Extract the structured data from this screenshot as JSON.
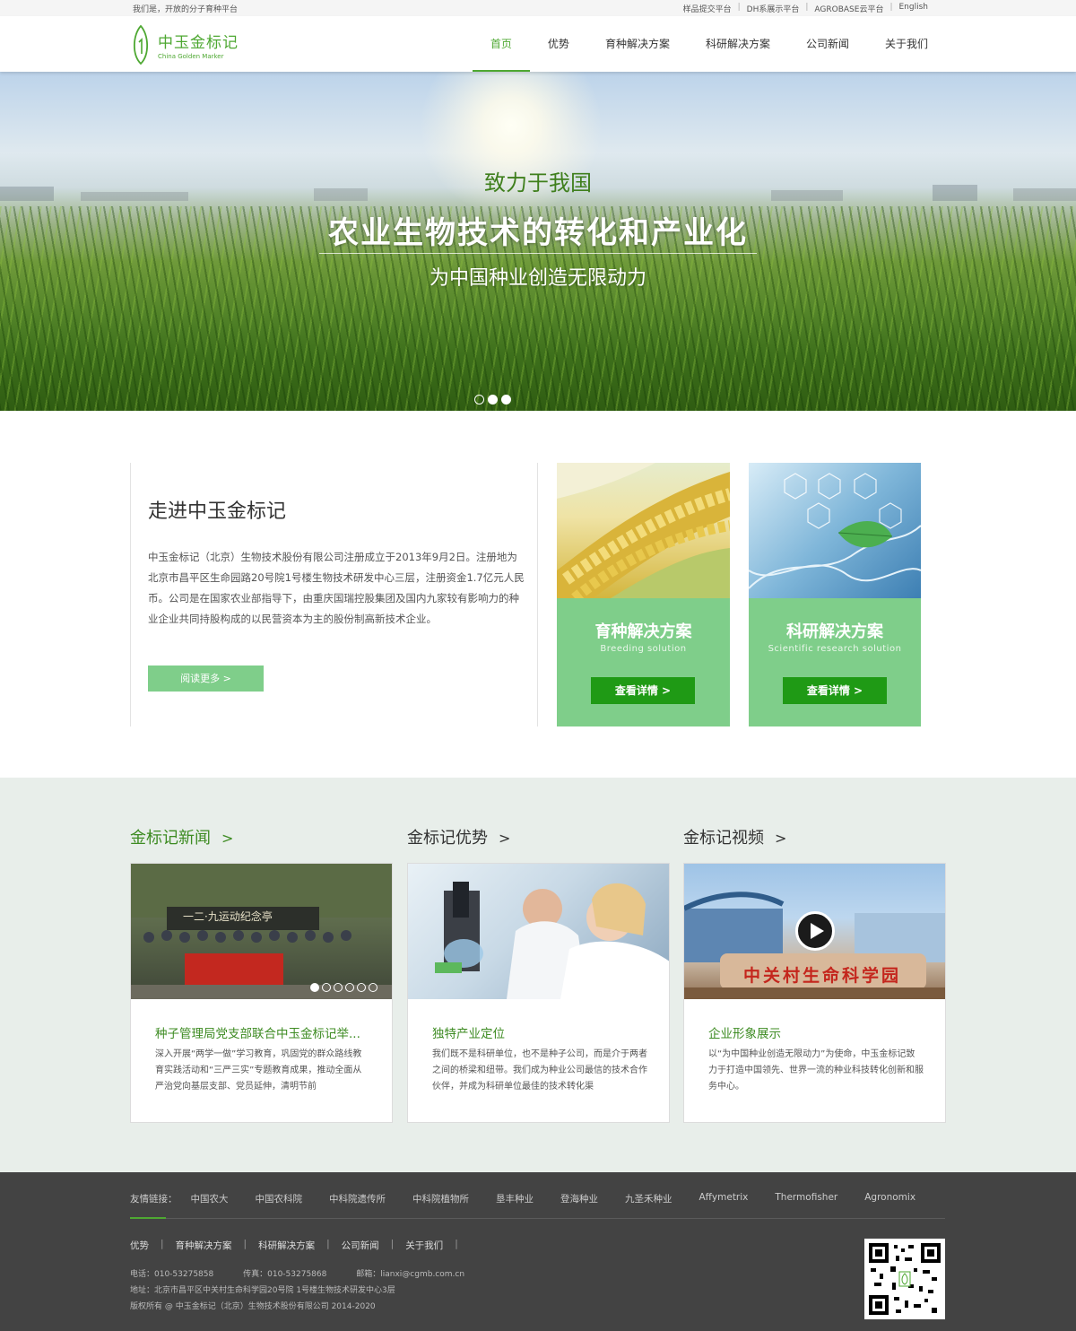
{
  "topbar": {
    "slogan": "我们是，开放的分子育种平台",
    "links": [
      "样品提交平台",
      "DH系展示平台",
      "AGROBASE云平台",
      "English"
    ],
    "separator": "|"
  },
  "header": {
    "logo_cn": "中玉金标记",
    "logo_en": "China Golden Marker",
    "nav": [
      "首页",
      "优势",
      "育种解决方案",
      "科研解决方案",
      "公司新闻",
      "关于我们"
    ],
    "active_nav": "首页"
  },
  "hero": {
    "line1": "致力于我国",
    "line2": "农业生物技术的转化和产业化",
    "line3": "为中国种业创造无限动力",
    "slides_total": 3,
    "slide_active": 1
  },
  "about": {
    "title": "走进中玉金标记",
    "body": "中玉金标记（北京）生物技术股份有限公司注册成立于2013年9月2日。注册地为北京市昌平区生命园路20号院1号楼生物技术研发中心三层，注册资金1.7亿元人民币。公司是在国家农业部指导下，由重庆国瑞控股集团及国内九家较有影响力的种业企业共同持股构成的以民营资本为主的股份制高新技术企业。",
    "read_more": "阅读更多  >"
  },
  "solutions": [
    {
      "title": "育种解决方案",
      "subtitle": "Breeding solution",
      "button": "查看详情  >"
    },
    {
      "title": "科研解决方案",
      "subtitle": "Scientific research solution",
      "button": "查看详情  >"
    }
  ],
  "columns": [
    {
      "heading": "金标记新闻",
      "arrow": ">",
      "card_title": "种子管理局党支部联合中玉金标记举...",
      "card_text": "深入开展“两学一做”学习教育，巩固党的群众路线教育实践活动和“三严三实”专题教育成果，推动全面从严治党向基层支部、党员延伸，清明节前",
      "image_banner_text": "一二·九运动纪念亭"
    },
    {
      "heading": "金标记优势",
      "arrow": ">",
      "card_title": "独特产业定位",
      "card_text": "我们既不是科研单位，也不是种子公司，而是介于两者之间的桥梁和纽带。我们成为种业公司最信的技术合作伙伴，并成为科研单位最佳的技术转化渠"
    },
    {
      "heading": "金标记视频",
      "arrow": ">",
      "card_title": "企业形象展示",
      "card_text": "以“为中国种业创造无限动力”为使命，中玉金标记致力于打造中国领先、世界一流的种业科技转化创新和服务中心。",
      "image_banner_text": "中关村生命科学园"
    }
  ],
  "footer": {
    "friends_label": "友情链接：",
    "friends": [
      "中国农大",
      "中国农科院",
      "中科院遗传所",
      "中科院植物所",
      "垦丰种业",
      "登海种业",
      "九圣禾种业",
      "Affymetrix",
      "Thermofisher",
      "Agronomix"
    ],
    "nav": [
      "优势",
      "育种解决方案",
      "科研解决方案",
      "公司新闻",
      "关于我们"
    ],
    "phone": "电话：010-53275858",
    "fax": "传真：010-53275868",
    "email": "邮箱：lianxi@cgmb.com.cn",
    "address": "地址：北京市昌平区中关村生命科学园20号院 1号楼生物技术研发中心3层",
    "copyright": "版权所有 @ 中玉金标记（北京）生物技术股份有限公司 2014-2020"
  },
  "colors": {
    "brand_green": "#4ea832",
    "card_green": "#7fce8a",
    "button_green": "#1f9a15",
    "footer_bg": "#434343"
  }
}
